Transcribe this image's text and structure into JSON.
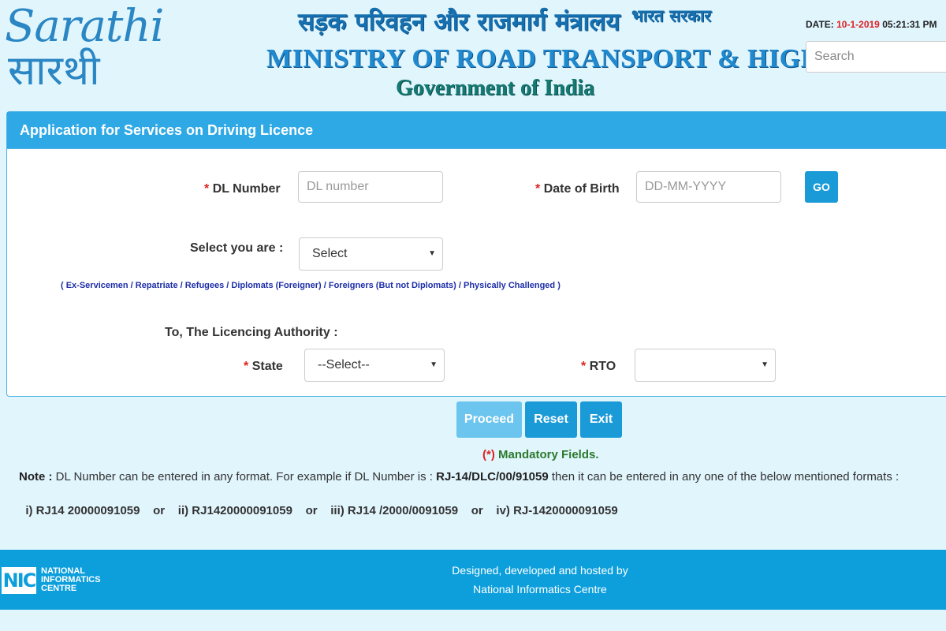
{
  "header": {
    "logo_text_en": "Sarathi",
    "logo_text_hi": "सारथी",
    "ministry_hi": "सड़क परिवहन और राजमार्ग मंत्रालय",
    "gov_hi": "भारत सरकार",
    "ministry_en": "MINISTRY OF ROAD TRANSPORT & HIGHWAYS",
    "gov_en": "Government of India",
    "date_label": "DATE:",
    "date_value": "10-1-2019",
    "time_value": "05:21:31 PM",
    "search_placeholder": "Search"
  },
  "panel": {
    "title": "Application for Services on Driving Licence",
    "required_mark": "*",
    "dl_label": "DL Number",
    "dl_placeholder": "DL number",
    "dob_label": "Date of Birth",
    "dob_placeholder": "DD-MM-YYYY",
    "go_label": "GO",
    "select_you_label": "Select you are :",
    "select_you_value": "Select",
    "categories_note": "( Ex-Servicemen / Repatriate / Refugees / Diplomats (Foreigner) / Foreigners (But not Diplomats) / Physically Challenged )",
    "authority_label": "To, The Licencing Authority :",
    "state_label": "State",
    "state_value": "--Select--",
    "rto_label": "RTO",
    "rto_value": "",
    "dropdown_arrow": "▼"
  },
  "actions": {
    "proceed": "Proceed",
    "reset": "Reset",
    "exit": "Exit"
  },
  "notes": {
    "mandatory_mark": "(*)",
    "mandatory_text": "Mandatory Fields.",
    "note_label": "Note :",
    "note_text": "DL Number can be entered in any format. For example if DL Number is :",
    "note_example": "RJ-14/DLC/00/91059",
    "note_text2": "then it can be entered in any one of the below mentioned formats :",
    "formats": "i) RJ14 20000091059    or    ii) RJ1420000091059    or    iii) RJ14 /2000/0091059    or    iv) RJ-1420000091059"
  },
  "footer": {
    "nic_logo": "NIC",
    "nic_line1": "NATIONAL",
    "nic_line2": "INFORMATICS",
    "nic_line3": "CENTRE",
    "line1": "Designed, developed and hosted by",
    "line2": "National Informatics Centre"
  },
  "colors": {
    "background": "#e1f5fd",
    "header_blue": "#2fa9e6",
    "button_blue": "#1b9ad8",
    "button_disabled": "#6cc5ee",
    "required_red": "#e02020",
    "footer_blue": "#0c9fdc"
  }
}
